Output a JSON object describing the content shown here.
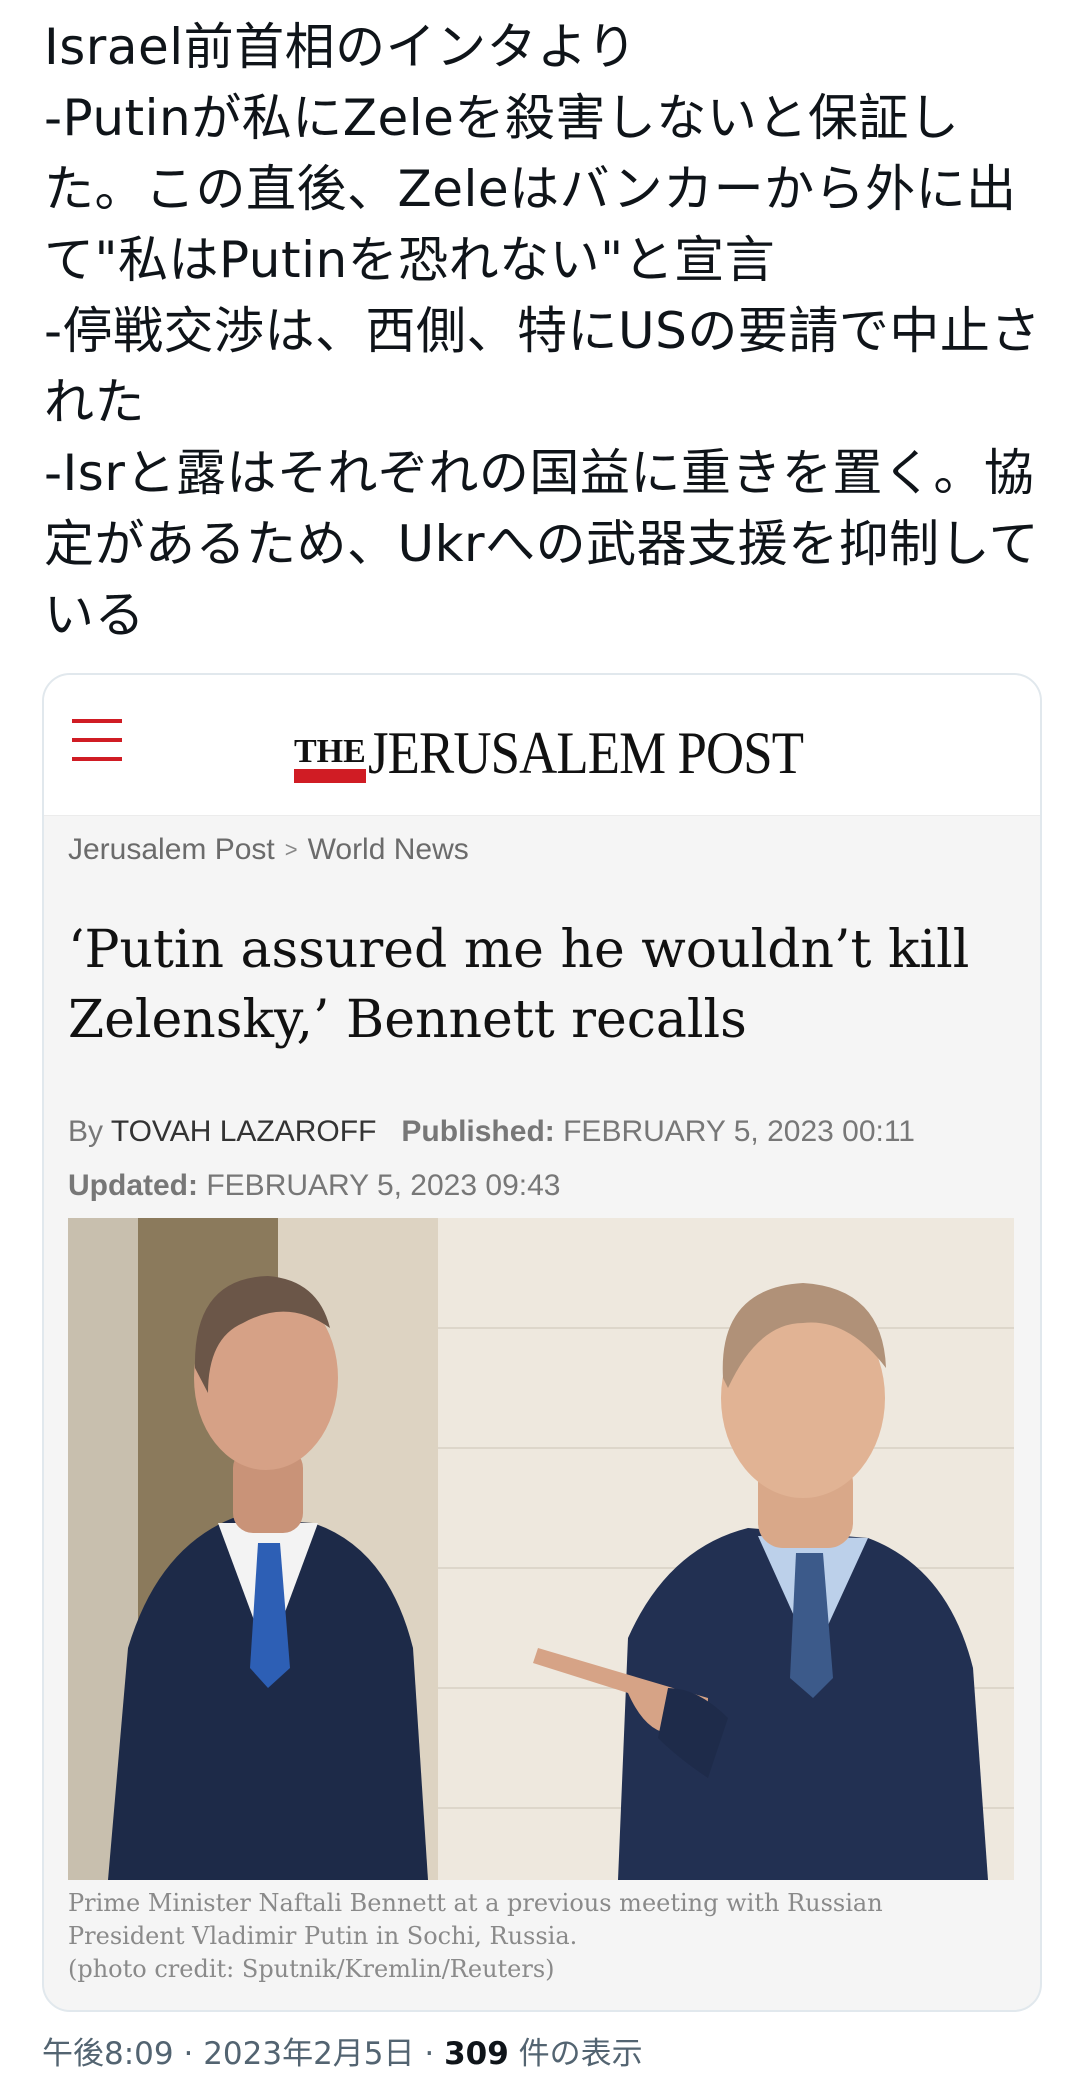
{
  "tweet": {
    "text": "Israel前首相のインタより\n-Putinが私にZeleを殺害しないと保証した。この直後、Zeleはバンカーから外に出て\"私はPutinを恐れない\"と宣言\n-停戦交渉は、西側、特にUSの要請で中止された\n-Isrと露はそれぞれの国益に重きを置く。協定があるため、Ukrへの武器支援を抑制している"
  },
  "card": {
    "logo_the": "THE",
    "logo_main": "JERUSALEM POST",
    "brand_color": "#d01c24",
    "breadcrumb": [
      "Jerusalem Post",
      "World News"
    ],
    "headline": "‘Putin assured me he wouldn’t kill Zelensky,’ Bennett recalls",
    "by_label": "By",
    "author": "TOVAH LAZAROFF",
    "published_label": "Published:",
    "published_value": "FEBRUARY 5, 2023 00:11",
    "updated_label": "Updated:",
    "updated_value": "FEBRUARY 5, 2023 09:43",
    "caption_line1": "Prime Minister Naftali Bennett at a previous meeting with Russian",
    "caption_line2": "President Vladimir Putin in Sochi, Russia.",
    "caption_line3": "(photo credit: Sputnik/Kremlin/Reuters)"
  },
  "meta": {
    "time": "午後8:09",
    "date": "2023年2月5日",
    "separator": " · ",
    "view_count": "309",
    "view_label": " 件の表示"
  }
}
